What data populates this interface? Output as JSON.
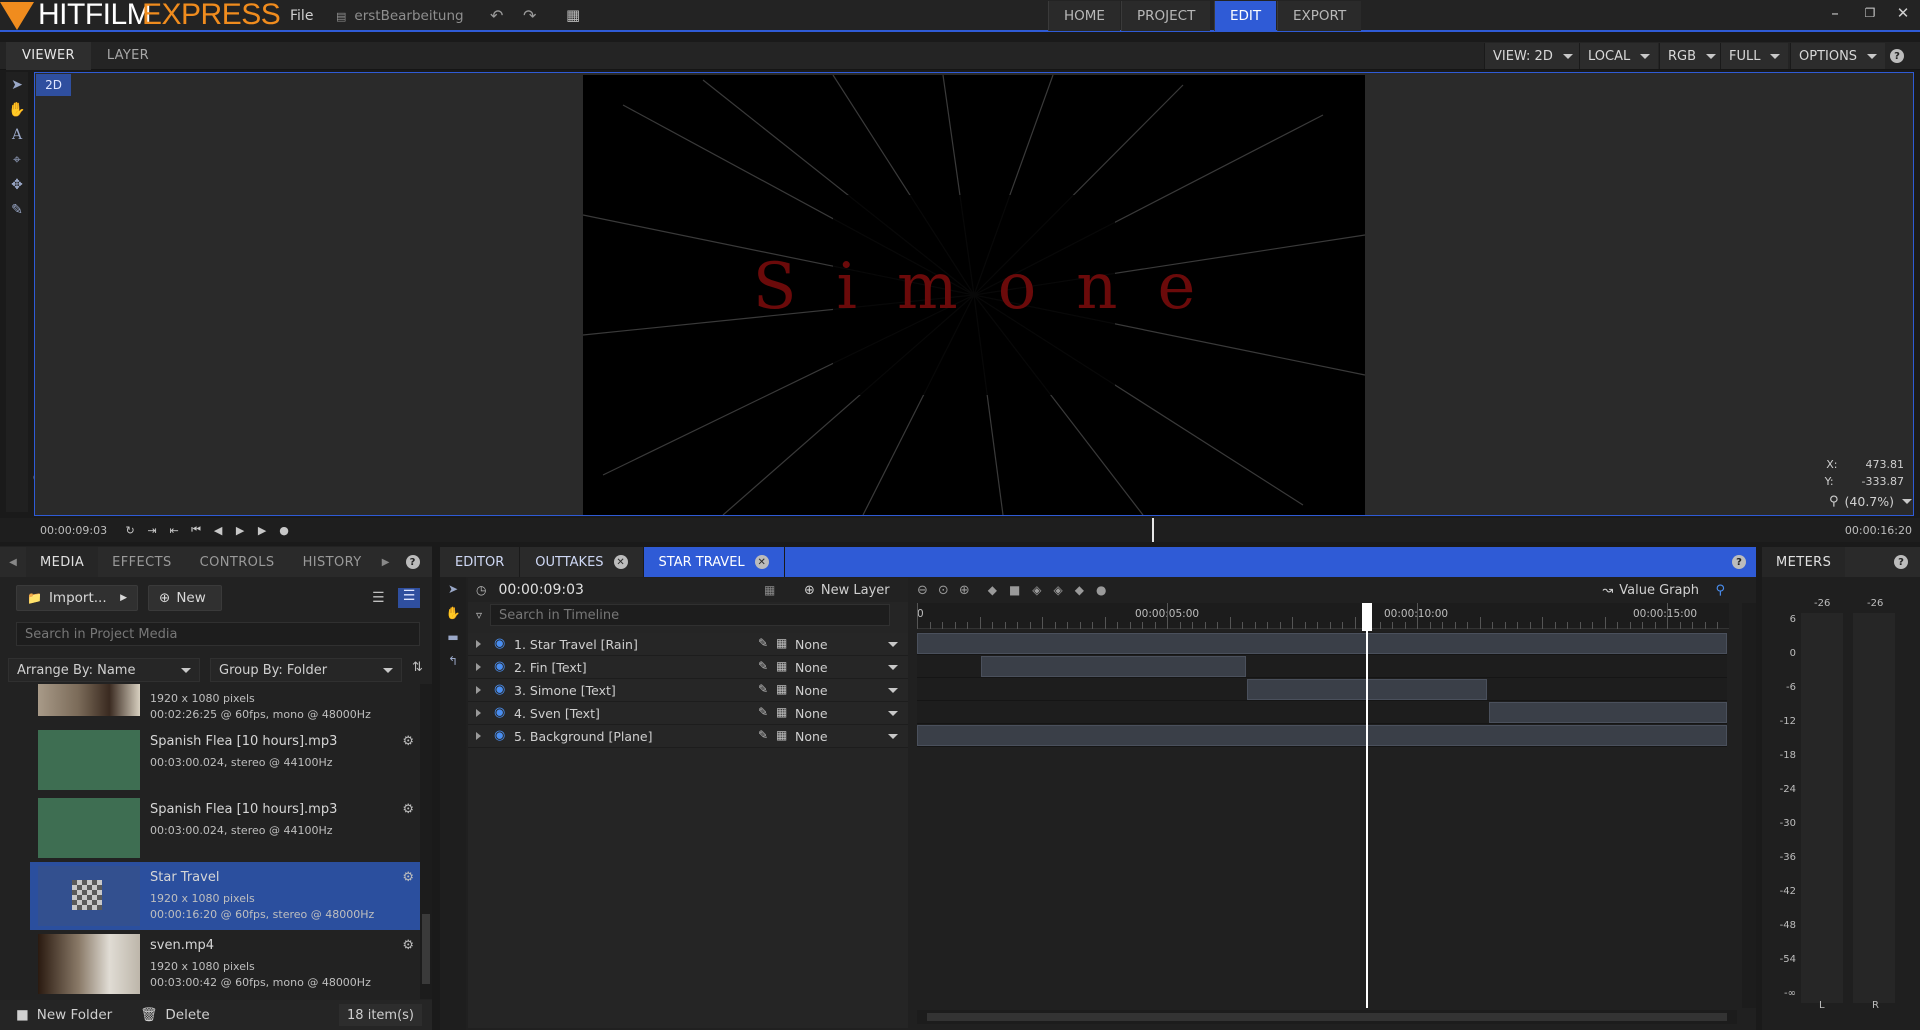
{
  "app": {
    "name_part1": "HITFILM",
    "name_part2": "EXPRESS",
    "menu_file": "File",
    "project_name": "erstBearbeitung"
  },
  "nav": {
    "tabs": [
      {
        "label": "HOME"
      },
      {
        "label": "PROJECT"
      },
      {
        "label": "EDIT"
      },
      {
        "label": "EXPORT"
      }
    ]
  },
  "viewer": {
    "tabs": [
      {
        "label": "VIEWER"
      },
      {
        "label": "LAYER"
      }
    ],
    "view_mode": "VIEW: 2D",
    "space": "LOCAL",
    "channels": "RGB",
    "quality": "FULL",
    "options": "OPTIONS",
    "badge": "2D",
    "canvas_text": "Simone",
    "coord_x_label": "X:",
    "coord_x": "473.81",
    "coord_y_label": "Y:",
    "coord_y": "-333.87",
    "zoom": "(40.7%)"
  },
  "transport": {
    "current_time": "00:00:09:03",
    "duration": "00:00:16:20"
  },
  "left_panel": {
    "tabs": [
      {
        "label": "MEDIA"
      },
      {
        "label": "EFFECTS"
      },
      {
        "label": "CONTROLS"
      },
      {
        "label": "HISTORY"
      }
    ],
    "import_label": "Import...",
    "new_label": "New",
    "search_placeholder": "Search in Project Media",
    "arrange_by": "Arrange By: Name",
    "group_by": "Group By: Folder",
    "items": [
      {
        "name": "",
        "meta1": "1920 x 1080 pixels",
        "meta2": "00:02:26:25 @ 60fps, mono @ 48000Hz"
      },
      {
        "name": "Spanish Flea [10 hours].mp3",
        "meta1": "00:03:00.024, stereo @ 44100Hz",
        "meta2": ""
      },
      {
        "name": "Spanish Flea [10 hours].mp3",
        "meta1": "00:03:00.024, stereo @ 44100Hz",
        "meta2": ""
      },
      {
        "name": "Star Travel",
        "meta1": "1920 x 1080 pixels",
        "meta2": "00:00:16:20 @ 60fps, stereo @ 48000Hz"
      },
      {
        "name": "sven.mp4",
        "meta1": "1920 x 1080 pixels",
        "meta2": "00:03:00:42 @ 60fps, mono @ 48000Hz"
      }
    ],
    "new_folder_label": "New Folder",
    "delete_label": "Delete",
    "item_count": "18 item(s)"
  },
  "editor": {
    "tabs": [
      {
        "label": "EDITOR"
      },
      {
        "label": "OUTTAKES"
      },
      {
        "label": "STAR TRAVEL"
      }
    ],
    "timecode": "00:00:09:03",
    "new_layer_label": "New Layer",
    "value_graph_label": "Value Graph",
    "search_placeholder": "Search in Timeline",
    "ruler": [
      "0",
      "00:00:05:00",
      "00:00:10:00",
      "00:00:15:00"
    ],
    "layers": [
      {
        "name": "1. Star Travel [Rain]",
        "blend": "None"
      },
      {
        "name": "2. Fin [Text]",
        "blend": "None"
      },
      {
        "name": "3. Simone [Text]",
        "blend": "None"
      },
      {
        "name": "4. Sven [Text]",
        "blend": "None"
      },
      {
        "name": "5. Background [Plane]",
        "blend": "None"
      }
    ]
  },
  "meters": {
    "title": "METERS",
    "peak_l": "-26",
    "peak_r": "-26",
    "scale": [
      "6",
      "0",
      "-6",
      "-12",
      "-18",
      "-24",
      "-30",
      "-36",
      "-42",
      "-48",
      "-54",
      "-∞"
    ],
    "ch_l": "L",
    "ch_r": "R"
  },
  "icons": {
    "accent": "#2f5bd6",
    "brand_orange": "#f08c1e"
  }
}
